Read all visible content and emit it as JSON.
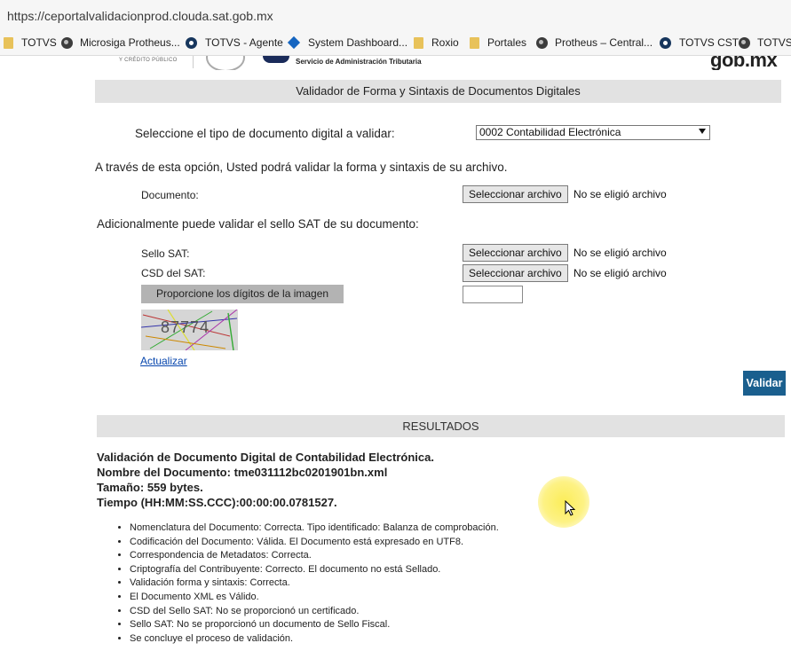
{
  "browser": {
    "url": "https://ceportalvalidacionprod.clouda.sat.gob.mx",
    "bookmarks": [
      {
        "label": "TOTVS",
        "icon": "folder-icon"
      },
      {
        "label": "Microsiga Protheus...",
        "icon": "globe-icon"
      },
      {
        "label": "TOTVS - Agente",
        "icon": "totvs-icon"
      },
      {
        "label": "System Dashboard...",
        "icon": "diamond-icon"
      },
      {
        "label": "Roxio",
        "icon": "folder-icon"
      },
      {
        "label": "Portales",
        "icon": "folder-icon"
      },
      {
        "label": "Protheus – Central...",
        "icon": "globe-icon"
      },
      {
        "label": "TOTVS CST",
        "icon": "totvs-icon"
      },
      {
        "label": "TOTVS",
        "icon": "globe-icon"
      }
    ]
  },
  "header": {
    "small_text": "Y CRÉDITO PÚBLICO",
    "sat_text": "Servicio de Administración Tributaria",
    "gob_text": "gob.mx"
  },
  "form": {
    "title": "Validador de Forma y Sintaxis de Documentos Digitales",
    "doc_type_label": "Seleccione el tipo de documento digital a validar:",
    "doc_type_value": "0002 Contabilidad Electrónica",
    "intro": "A través de esta opción, Usted podrá validar la forma y sintaxis de su archivo.",
    "documento_label": "Documento:",
    "sello_intro": "Adicionalmente puede validar el sello SAT de su documento:",
    "sello_label": "Sello SAT:",
    "csd_label": "CSD del SAT:",
    "file_button": "Seleccionar archivo",
    "no_file": "No se eligió archivo",
    "captcha_label": "Proporcione los dígitos de la imagen",
    "captcha_code": "87774",
    "refresh_link": "Actualizar",
    "submit": "Validar"
  },
  "results": {
    "title": "RESULTADOS",
    "heading": "Validación de Documento Digital de Contabilidad Electrónica.",
    "doc_name": "Nombre del Documento: tme031112bc0201901bn.xml",
    "size": "Tamaño: 559 bytes.",
    "time": "Tiempo (HH:MM:SS.CCC):00:00:00.0781527.",
    "messages": [
      "Nomenclatura del Documento: Correcta. Tipo identificado: Balanza de comprobación.",
      "Codificación del Documento: Válida. El Documento está expresado en UTF8.",
      "Correspondencia de Metadatos: Correcta.",
      "Criptografía del Contribuyente: Correcto. El documento no está Sellado.",
      "Validación forma y sintaxis: Correcta.",
      "El Documento XML es Válido.",
      "CSD del Sello SAT: No se proporcionó un certificado.",
      "Sello SAT: No se proporcionó un documento de Sello Fiscal.",
      "Se concluye el proceso de validación."
    ]
  },
  "colors": {
    "accent": "#1a5f8e",
    "bar": "#e2e2e2",
    "highlight": "#fcec50"
  }
}
